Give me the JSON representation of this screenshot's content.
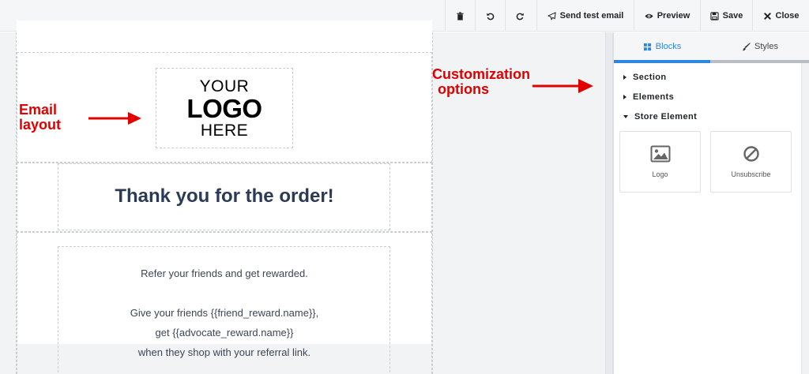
{
  "toolbar": {
    "icons": [
      "trash-icon",
      "undo-icon",
      "redo-icon"
    ],
    "send_test_email": "Send test email",
    "preview": "Preview",
    "save": "Save",
    "close": "Close"
  },
  "email": {
    "logo": {
      "line1": "YOUR",
      "line2": "LOGO",
      "line3": "HERE"
    },
    "title": "Thank you for the order!",
    "paragraph1": "Refer your friends and get rewarded.",
    "paragraph2_line1": "Give your friends {{friend_reward.name}},",
    "paragraph2_line2": "get {{advocate_reward.name}}",
    "paragraph2_line3": "when they shop with your referral link."
  },
  "annotations": {
    "email_layout_line1": "Email",
    "email_layout_line2": "layout",
    "customization_line1": "Customization",
    "customization_line2": "options"
  },
  "panel": {
    "tabs": [
      {
        "label": "Blocks",
        "icon": "grid-icon",
        "active": true
      },
      {
        "label": "Styles",
        "icon": "brush-icon",
        "active": false
      }
    ],
    "sections": [
      {
        "label": "Section",
        "expanded": false
      },
      {
        "label": "Elements",
        "expanded": false
      },
      {
        "label": "Store Element",
        "expanded": true
      }
    ],
    "blocks": [
      {
        "label": "Logo",
        "icon": "image-icon"
      },
      {
        "label": "Unsubscribe",
        "icon": "prohibited-icon"
      }
    ]
  },
  "colors": {
    "accent": "#2e86de",
    "annotation": "#e10000",
    "title": "#2b3a55",
    "tab_inactive_bar": "#b9bdc4"
  }
}
